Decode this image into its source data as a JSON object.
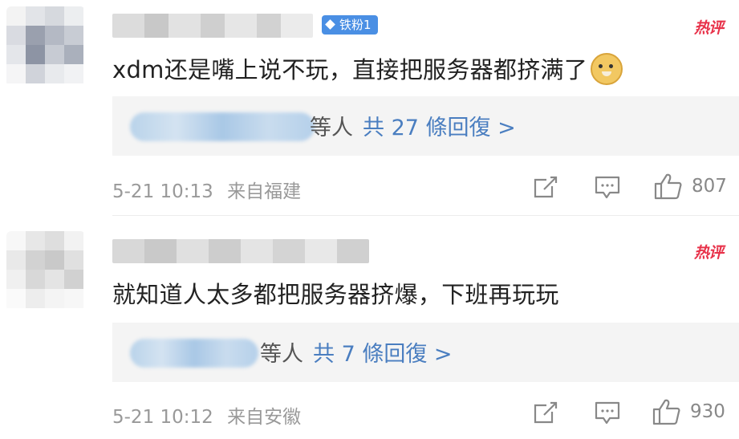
{
  "comments": [
    {
      "badge": "铁粉1",
      "hot_label": "热评",
      "text": "xdm还是嘴上说不玩，直接把服务器都挤满了",
      "emoji": "dog-face-emoji",
      "reply_suffix": "等人",
      "reply_link": "共 27 條回復 >",
      "date": "5-21 10:13",
      "location": "来自福建",
      "like_count": "807"
    },
    {
      "hot_label": "热评",
      "text": "就知道人太多都把服务器挤爆，下班再玩玩",
      "reply_suffix": "等人",
      "reply_link": "共 7 條回復 >",
      "date": "5-21 10:12",
      "location": "来自安徽",
      "like_count": "930"
    }
  ],
  "colors": {
    "hot": "#e8324a",
    "link": "#4a7ec0",
    "badge": "#4a8fe4",
    "meta": "#999999"
  }
}
